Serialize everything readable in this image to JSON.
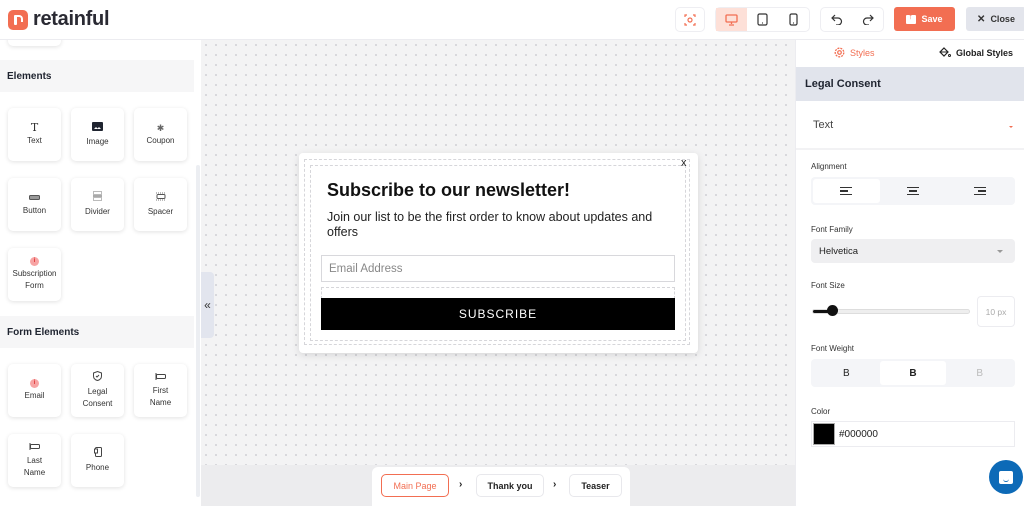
{
  "app": {
    "brand": "retainful"
  },
  "toolbar": {
    "preview_icon": "eye-scan-icon",
    "devices": [
      {
        "name": "desktop",
        "icon": "monitor-icon",
        "active": true
      },
      {
        "name": "tablet",
        "icon": "tablet-icon",
        "active": false
      },
      {
        "name": "mobile",
        "icon": "phone-icon",
        "active": false
      }
    ],
    "undo_icon": "undo-icon",
    "redo_icon": "redo-icon",
    "save_label": "Save",
    "close_label": "Close",
    "accent": "#f26e52"
  },
  "sidebar": {
    "sections": [
      {
        "title": "Elements",
        "items": [
          {
            "label": "Text",
            "icon": "T"
          },
          {
            "label": "Image",
            "icon": "▀"
          },
          {
            "label": "Coupon",
            "icon": "✱"
          },
          {
            "label": "Button",
            "icon": "▭"
          },
          {
            "label": "Divider",
            "icon": "☰"
          },
          {
            "label": "Spacer",
            "icon": "⊟"
          },
          {
            "label": "Subscription Form",
            "icon": "i"
          }
        ]
      },
      {
        "title": "Form Elements",
        "items": [
          {
            "label": "Email",
            "icon": "i"
          },
          {
            "label": "Legal Consent",
            "icon": "⛉"
          },
          {
            "label": "First Name",
            "icon": "⊏"
          },
          {
            "label": "Last Name",
            "icon": "⊏"
          },
          {
            "label": "Phone",
            "icon": "▯"
          }
        ]
      }
    ]
  },
  "canvas": {
    "collapse_label": "«",
    "popup": {
      "close_label": "x",
      "title": "Subscribe to our newsletter!",
      "description": "Join our list to be the first order to know about updates and offers",
      "email_placeholder": "Email Address",
      "button_label": "SUBSCRIBE"
    },
    "pages": [
      {
        "label": "Main Page",
        "active": true
      },
      {
        "label": "Thank you",
        "active": false
      },
      {
        "label": "Teaser",
        "active": false
      }
    ],
    "page_separator": "›"
  },
  "right_panel": {
    "tabs": [
      {
        "label": "Styles",
        "active": true
      },
      {
        "label": "Global Styles",
        "active": false
      }
    ],
    "section_title": "Legal Consent",
    "target_select": "Text",
    "alignment": {
      "label": "Alignment",
      "options": [
        "left",
        "center",
        "right"
      ],
      "selected": "left"
    },
    "font_family": {
      "label": "Font Family",
      "value": "Helvetica"
    },
    "font_size": {
      "label": "Font Size",
      "value": "10 px",
      "slider_fraction": 0.1
    },
    "font_weight": {
      "label": "Font Weight",
      "options": [
        "B",
        "B",
        "B"
      ],
      "selected_index": 1
    },
    "color": {
      "label": "Color",
      "value": "#000000"
    }
  }
}
